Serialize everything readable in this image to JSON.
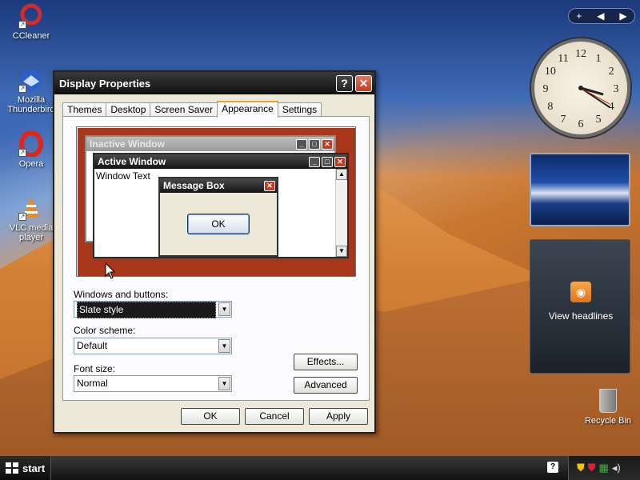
{
  "desktop_icons": [
    {
      "label": "CCleaner"
    },
    {
      "label": "Mozilla Thunderbird"
    },
    {
      "label": "Opera"
    },
    {
      "label": "VLC media player"
    }
  ],
  "recycle_bin": {
    "label": "Recycle Bin"
  },
  "window": {
    "title": "Display Properties",
    "tabs": [
      "Themes",
      "Desktop",
      "Screen Saver",
      "Appearance",
      "Settings"
    ],
    "active_tab": "Appearance",
    "preview": {
      "inactive_title": "Inactive Window",
      "active_title": "Active Window",
      "window_text": "Window Text",
      "message_title": "Message Box",
      "ok_label": "OK"
    },
    "windows_buttons": {
      "label": "Windows and buttons:",
      "value": "Slate style"
    },
    "color_scheme": {
      "label": "Color scheme:",
      "value": "Default"
    },
    "font_size": {
      "label": "Font size:",
      "value": "Normal"
    },
    "effects_label": "Effects...",
    "advanced_label": "Advanced",
    "ok_label": "OK",
    "cancel_label": "Cancel",
    "apply_label": "Apply"
  },
  "sidebar": {
    "add_label": "+",
    "clock_numbers": [
      "12",
      "1",
      "2",
      "3",
      "4",
      "5",
      "6",
      "7",
      "8",
      "9",
      "10",
      "11"
    ],
    "feed_label": "View headlines"
  },
  "taskbar": {
    "start_label": "start"
  },
  "colors": {
    "preview_bg": "#a8361a",
    "title_dark": "#151515",
    "accent_tab": "#e6a437"
  }
}
